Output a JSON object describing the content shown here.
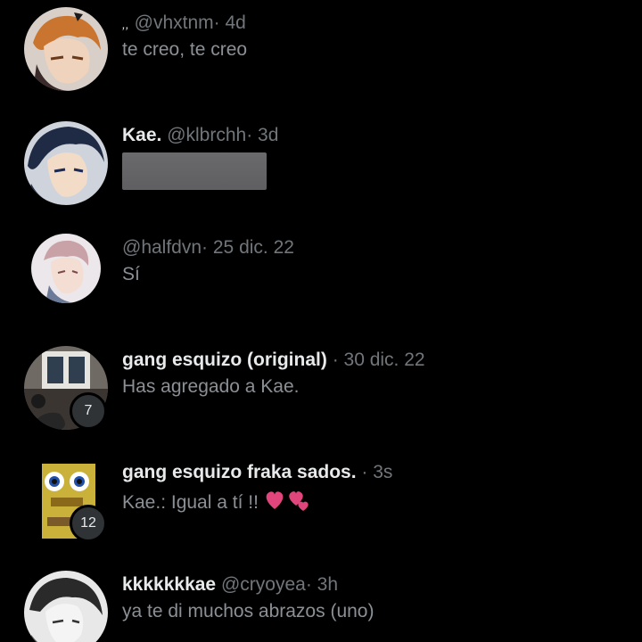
{
  "conversations": [
    {
      "name_prefix": ",,",
      "name": "",
      "handle": "@vhxtnm",
      "time": "· 4d",
      "preview": "te creo, te creo"
    },
    {
      "name": "Kae.",
      "handle": "@klbrchh",
      "time": "· 3d",
      "preview": ""
    },
    {
      "name": "",
      "handle": "@halfdvn",
      "time": "· 25 dic. 22",
      "preview": "Sí"
    },
    {
      "name": "gang esquizo (original)",
      "handle": "",
      "time": "· 30 dic. 22",
      "preview": "Has agregado a Kae.",
      "member_count": "7"
    },
    {
      "name": "gang esquizo fraka sados.",
      "handle": "",
      "time": "· 3s",
      "preview": "Kae.: Igual a tí !!",
      "preview_emoji": "two-hearts-icon",
      "member_count": "12"
    },
    {
      "name": "kkkkkkkae",
      "handle": "@cryoyea",
      "time": "· 3h",
      "preview": "ya te di muchos abrazos (uno)"
    }
  ],
  "colors": {
    "background": "#000000",
    "primary_text": "#e7e9ea",
    "secondary_text": "#71767b",
    "badge_bg": "#2f3336",
    "heart": "#e0457b"
  }
}
